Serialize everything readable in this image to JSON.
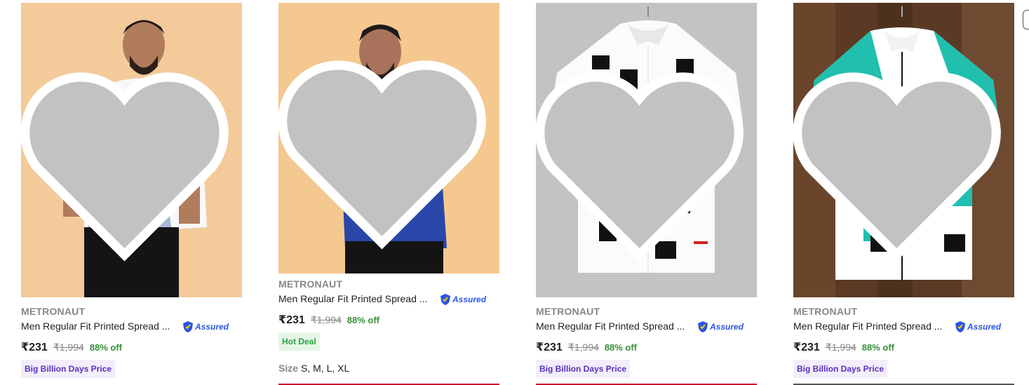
{
  "products": [
    {
      "brand": "METRONAUT",
      "title": "Men Regular Fit Printed Spread ...",
      "assured": "Assured",
      "price": "₹231",
      "mrp": "₹1,994",
      "discount": "88% off",
      "badge": "Big Billion Days Price",
      "image_desc": "man in white shirt with blue ink-landscape print"
    },
    {
      "brand": "METRONAUT",
      "title": "Men Regular Fit Printed Spread ...",
      "assured": "Assured",
      "price": "₹231",
      "mrp": "₹1,994",
      "discount": "88% off",
      "badge": "Hot Deal",
      "size_label": "Size",
      "sizes": "S, M, L, XL",
      "image_desc": "man in blue abstract printed shirt"
    },
    {
      "brand": "METRONAUT",
      "title": "Men Regular Fit Printed Spread ...",
      "assured": "Assured",
      "price": "₹231",
      "mrp": "₹1,994",
      "discount": "88% off",
      "badge": "Big Billion Days Price",
      "image_desc": "white shirt with black and red geometric shapes on hanger"
    },
    {
      "brand": "METRONAUT",
      "title": "Men Regular Fit Printed Spread ...",
      "assured": "Assured",
      "price": "₹231",
      "mrp": "₹1,994",
      "discount": "88% off",
      "badge": "Big Billion Days Price",
      "image_desc": "teal and white geometric shirt on wooden background"
    }
  ],
  "colors": {
    "brand_grey": "#878787",
    "discount_green": "#388e3c",
    "assured_blue": "#2a55e5",
    "bbd_purple": "#5b2fbf",
    "hot_deal_green": "#26a541",
    "heart_grey": "#c2c2c2"
  }
}
